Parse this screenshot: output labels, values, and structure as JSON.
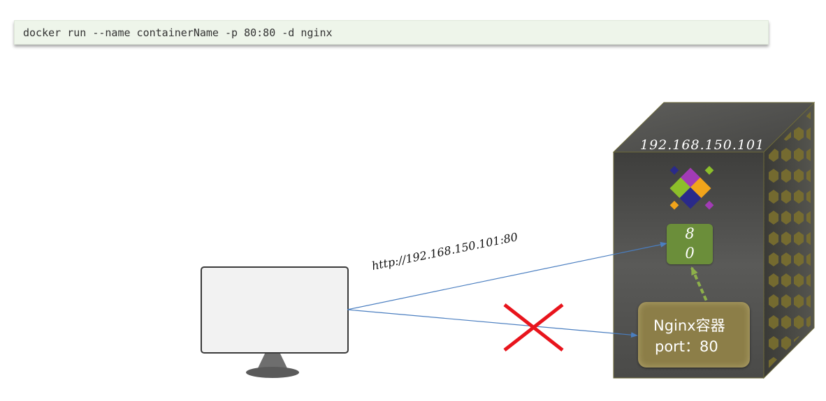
{
  "command": {
    "text": "docker run --name containerName -p 80:80 -d nginx"
  },
  "diagram": {
    "host_ip": "192.168.150.101",
    "host_port": "80",
    "container": {
      "title": "Nginx容器",
      "port": "port：80"
    },
    "request_url": "http://192.168.150.101:80",
    "colors": {
      "server_body": "#4a4a48",
      "port_box": "#6b8e3a",
      "container_box": "#8c7e48",
      "arrow": "#4a7ec0",
      "mapping_arrow": "#8db04a",
      "blocked_mark": "#e8141c"
    },
    "icons": {
      "docker_logo": "colorful-diamond-logo-icon",
      "client": "monitor-icon",
      "blocked": "red-x-icon"
    }
  }
}
